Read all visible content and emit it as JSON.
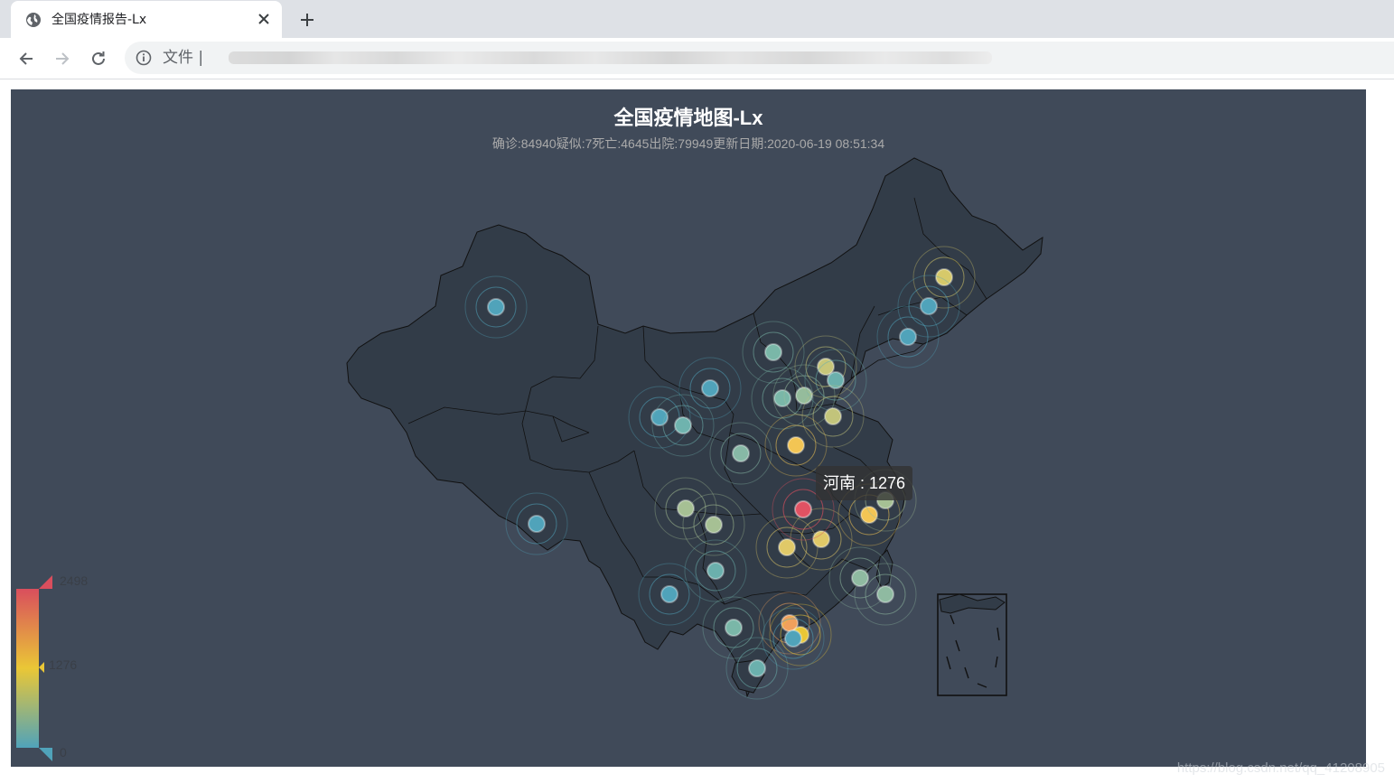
{
  "browser": {
    "tab_title": "全国疫情报告-Lx",
    "address_label": "文件 |",
    "icons": [
      "globe-icon",
      "close-icon",
      "plus-icon",
      "back-icon",
      "forward-icon",
      "reload-icon",
      "info-icon"
    ]
  },
  "chart_data": {
    "type": "map",
    "title": "全国疫情地图-Lx",
    "subtitle": "确诊:84940疑似:7死亡:4645出院:79949更新日期:2020-06-19 08:51:34",
    "visual_map": {
      "min": 0,
      "max": 2498,
      "min_label": "0",
      "max_label": "2498",
      "pointer_label": "1276",
      "pointer_value": 1276,
      "colors": [
        "#50a3ba",
        "#eac736",
        "#d94e5d"
      ]
    },
    "tooltip": {
      "region": "河南",
      "value": 1276,
      "text": "河南 : 1276"
    },
    "highlighted": {
      "region": "河南",
      "value": 1276
    },
    "background": "#404a59",
    "region_fill": "#323c48",
    "region_border": "#111111"
  },
  "watermark": "https://blog.csdn.net/qq_41208905"
}
